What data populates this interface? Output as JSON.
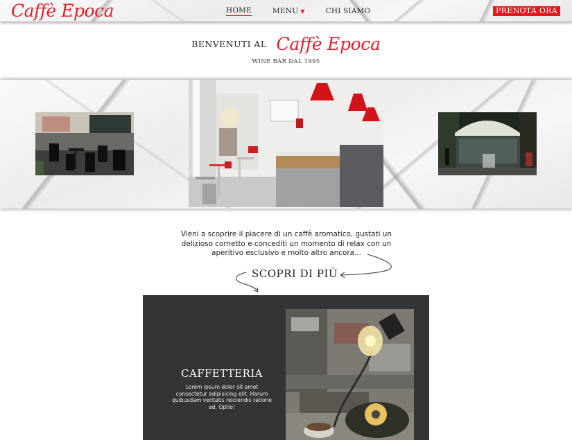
{
  "brand": {
    "logo_text": "Caffè Epoca",
    "accent_color": "#e41e2b"
  },
  "nav": {
    "items": [
      {
        "label": "HOME",
        "active": true
      },
      {
        "label": "MENU",
        "has_dropdown": true
      },
      {
        "label": "CHI SIAMO"
      }
    ],
    "cta_label": "PRENOTA ORA"
  },
  "hero": {
    "welcome": "BENVENUTI AL",
    "logo_text": "Caffè Epoca",
    "subtitle": "WINE BAR DAL 1995"
  },
  "intro": {
    "text": "Vieni a scoprire il piacere di un caffè aromatico, gustati un delizioso cornetto e concediti un momento di relax con un aperitivo esclusivo e molto altro ancora...",
    "discover_label": "SCOPRI DI PIÙ"
  },
  "card": {
    "title": "CAFFETTERIA",
    "body": "Lorem ipsum dolor sit amet consectetur adipisicing elit. Harum quibusdam veritatis reiciendis ratione ad. Optio!",
    "background_color": "#343434"
  }
}
